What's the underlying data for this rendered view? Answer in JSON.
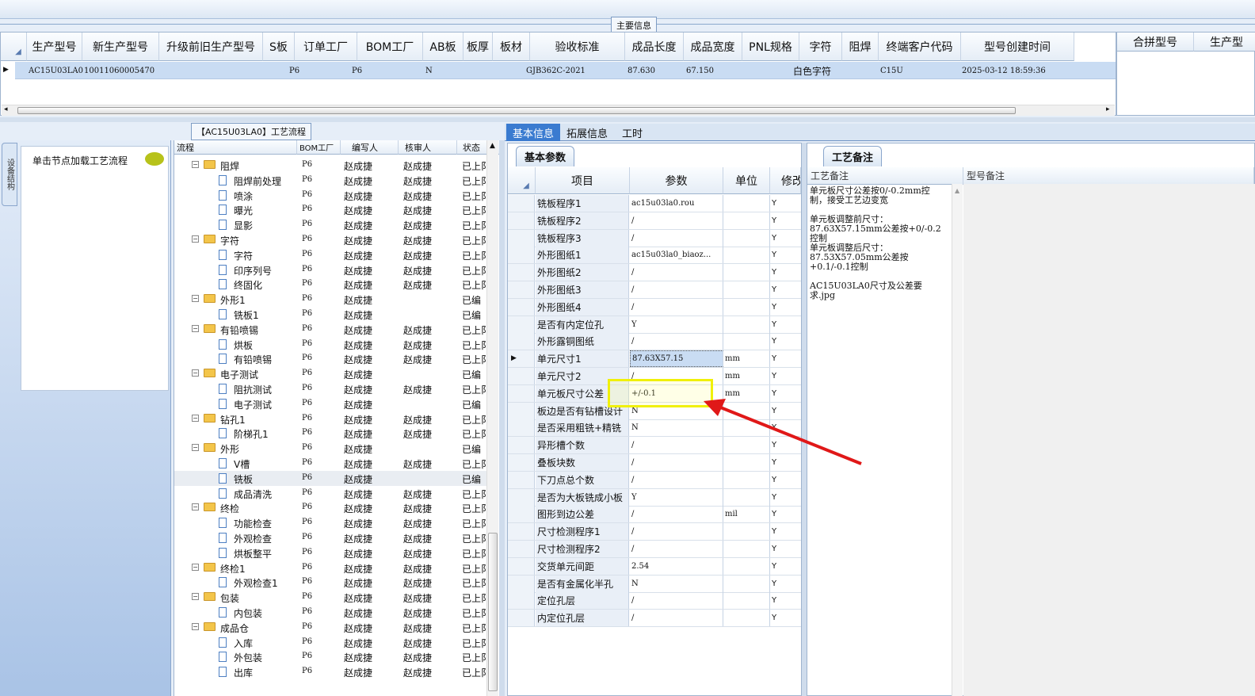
{
  "main_group_label": "主要信息",
  "top_grid": {
    "columns": [
      "生产型号",
      "新生产型号",
      "升级前旧生产型号",
      "S板",
      "订单工厂",
      "BOM工厂",
      "AB板",
      "板厚",
      "板材",
      "验收标准",
      "成品长度",
      "成品宽度",
      "PNL规格",
      "字符",
      "阻焊",
      "终端客户代码",
      "型号创建时间"
    ],
    "row": {
      "生产型号": "AC15U03LA0",
      "新生产型号": "10011060005470",
      "订单工厂": "P6",
      "BOM工厂": "P6",
      "AB板": "N",
      "验收标准": "GJB362C-2021",
      "成品长度": "87.630",
      "成品宽度": "67.150",
      "字符": "白色字符",
      "终端客户代码": "C15U",
      "型号创建时间": "2025-03-12 18:59:36"
    }
  },
  "right_grid": {
    "columns": [
      "合拼型号",
      "生产型"
    ]
  },
  "left_panel": {
    "side_tab": "设备结构",
    "load_hint": "单击节点加载工艺流程"
  },
  "tree": {
    "title": "【AC15U03LA0】工艺流程",
    "columns": [
      "流程",
      "BOM工厂",
      "编写人",
      "核审人",
      "状态"
    ],
    "rows": [
      {
        "level": 1,
        "name": "阻焊",
        "factory": "P6",
        "writer": "赵成捷",
        "reviewer": "赵成捷",
        "status": "已上阝"
      },
      {
        "level": 2,
        "name": "阻焊前处理",
        "factory": "P6",
        "writer": "赵成捷",
        "reviewer": "赵成捷",
        "status": "已上阝"
      },
      {
        "level": 2,
        "name": "喷涂",
        "factory": "P6",
        "writer": "赵成捷",
        "reviewer": "赵成捷",
        "status": "已上阝"
      },
      {
        "level": 2,
        "name": "曝光",
        "factory": "P6",
        "writer": "赵成捷",
        "reviewer": "赵成捷",
        "status": "已上阝"
      },
      {
        "level": 2,
        "name": "显影",
        "factory": "P6",
        "writer": "赵成捷",
        "reviewer": "赵成捷",
        "status": "已上阝"
      },
      {
        "level": 1,
        "name": "字符",
        "factory": "P6",
        "writer": "赵成捷",
        "reviewer": "赵成捷",
        "status": "已上阝"
      },
      {
        "level": 2,
        "name": "字符",
        "factory": "P6",
        "writer": "赵成捷",
        "reviewer": "赵成捷",
        "status": "已上阝"
      },
      {
        "level": 2,
        "name": "印序列号",
        "factory": "P6",
        "writer": "赵成捷",
        "reviewer": "赵成捷",
        "status": "已上阝"
      },
      {
        "level": 2,
        "name": "终固化",
        "factory": "P6",
        "writer": "赵成捷",
        "reviewer": "赵成捷",
        "status": "已上阝"
      },
      {
        "level": 1,
        "name": "外形1",
        "factory": "P6",
        "writer": "赵成捷",
        "reviewer": "",
        "status": "已编"
      },
      {
        "level": 2,
        "name": "铣板1",
        "factory": "P6",
        "writer": "赵成捷",
        "reviewer": "",
        "status": "已编"
      },
      {
        "level": 1,
        "name": "有铅喷锡",
        "factory": "P6",
        "writer": "赵成捷",
        "reviewer": "赵成捷",
        "status": "已上阝"
      },
      {
        "level": 2,
        "name": "烘板",
        "factory": "P6",
        "writer": "赵成捷",
        "reviewer": "赵成捷",
        "status": "已上阝"
      },
      {
        "level": 2,
        "name": "有铅喷锡",
        "factory": "P6",
        "writer": "赵成捷",
        "reviewer": "赵成捷",
        "status": "已上阝"
      },
      {
        "level": 1,
        "name": "电子测试",
        "factory": "P6",
        "writer": "赵成捷",
        "reviewer": "",
        "status": "已编"
      },
      {
        "level": 2,
        "name": "阻抗测试",
        "factory": "P6",
        "writer": "赵成捷",
        "reviewer": "赵成捷",
        "status": "已上阝"
      },
      {
        "level": 2,
        "name": "电子测试",
        "factory": "P6",
        "writer": "赵成捷",
        "reviewer": "",
        "status": "已编"
      },
      {
        "level": 1,
        "name": "钻孔1",
        "factory": "P6",
        "writer": "赵成捷",
        "reviewer": "赵成捷",
        "status": "已上阝"
      },
      {
        "level": 2,
        "name": "阶梯孔1",
        "factory": "P6",
        "writer": "赵成捷",
        "reviewer": "赵成捷",
        "status": "已上阝"
      },
      {
        "level": 1,
        "name": "外形",
        "factory": "P6",
        "writer": "赵成捷",
        "reviewer": "",
        "status": "已编"
      },
      {
        "level": 2,
        "name": "V槽",
        "factory": "P6",
        "writer": "赵成捷",
        "reviewer": "赵成捷",
        "status": "已上阝"
      },
      {
        "level": 2,
        "name": "铣板",
        "factory": "P6",
        "writer": "赵成捷",
        "reviewer": "",
        "status": "已编",
        "selected": true
      },
      {
        "level": 2,
        "name": "成品清洗",
        "factory": "P6",
        "writer": "赵成捷",
        "reviewer": "赵成捷",
        "status": "已上阝"
      },
      {
        "level": 1,
        "name": "终检",
        "factory": "P6",
        "writer": "赵成捷",
        "reviewer": "赵成捷",
        "status": "已上阝"
      },
      {
        "level": 2,
        "name": "功能检查",
        "factory": "P6",
        "writer": "赵成捷",
        "reviewer": "赵成捷",
        "status": "已上阝"
      },
      {
        "level": 2,
        "name": "外观检查",
        "factory": "P6",
        "writer": "赵成捷",
        "reviewer": "赵成捷",
        "status": "已上阝"
      },
      {
        "level": 2,
        "name": "烘板整平",
        "factory": "P6",
        "writer": "赵成捷",
        "reviewer": "赵成捷",
        "status": "已上阝"
      },
      {
        "level": 1,
        "name": "终检1",
        "factory": "P6",
        "writer": "赵成捷",
        "reviewer": "赵成捷",
        "status": "已上阝"
      },
      {
        "level": 2,
        "name": "外观检查1",
        "factory": "P6",
        "writer": "赵成捷",
        "reviewer": "赵成捷",
        "status": "已上阝"
      },
      {
        "level": 1,
        "name": "包装",
        "factory": "P6",
        "writer": "赵成捷",
        "reviewer": "赵成捷",
        "status": "已上阝"
      },
      {
        "level": 2,
        "name": "内包装",
        "factory": "P6",
        "writer": "赵成捷",
        "reviewer": "赵成捷",
        "status": "已上阝"
      },
      {
        "level": 1,
        "name": "成品仓",
        "factory": "P6",
        "writer": "赵成捷",
        "reviewer": "赵成捷",
        "status": "已上阝"
      },
      {
        "level": 2,
        "name": "入库",
        "factory": "P6",
        "writer": "赵成捷",
        "reviewer": "赵成捷",
        "status": "已上阝"
      },
      {
        "level": 2,
        "name": "外包装",
        "factory": "P6",
        "writer": "赵成捷",
        "reviewer": "赵成捷",
        "status": "已上阝"
      },
      {
        "level": 2,
        "name": "出库",
        "factory": "P6",
        "writer": "赵成捷",
        "reviewer": "赵成捷",
        "status": "已上阝"
      }
    ]
  },
  "tabs": [
    "基本信息",
    "拓展信息",
    "工时"
  ],
  "params": {
    "subtab": "基本参数",
    "columns": [
      "项目",
      "参数",
      "单位",
      "修改"
    ],
    "rows": [
      {
        "item": "铣板程序1",
        "value": "ac15u03la0.rou",
        "unit": "",
        "mod": "Y"
      },
      {
        "item": "铣板程序2",
        "value": "/",
        "unit": "",
        "mod": "Y"
      },
      {
        "item": "铣板程序3",
        "value": "/",
        "unit": "",
        "mod": "Y"
      },
      {
        "item": "外形图纸1",
        "value": "ac15u03la0_biaoz...",
        "unit": "",
        "mod": "Y"
      },
      {
        "item": "外形图纸2",
        "value": "/",
        "unit": "",
        "mod": "Y"
      },
      {
        "item": "外形图纸3",
        "value": "/",
        "unit": "",
        "mod": "Y"
      },
      {
        "item": "外形图纸4",
        "value": "/",
        "unit": "",
        "mod": "Y"
      },
      {
        "item": "是否有内定位孔",
        "value": "Y",
        "unit": "",
        "mod": "Y"
      },
      {
        "item": "外形露铜图纸",
        "value": "/",
        "unit": "",
        "mod": "Y"
      },
      {
        "item": "单元尺寸1",
        "value": "87.63X57.15",
        "unit": "mm",
        "mod": "Y",
        "selected": true
      },
      {
        "item": "单元尺寸2",
        "value": "/",
        "unit": "mm",
        "mod": "Y"
      },
      {
        "item": "单元板尺寸公差",
        "value": "+/-0.1",
        "unit": "mm",
        "mod": "Y"
      },
      {
        "item": "板边是否有钻槽设计",
        "value": "N",
        "unit": "",
        "mod": "Y"
      },
      {
        "item": "是否采用粗铣+精铣",
        "value": "N",
        "unit": "",
        "mod": "Y"
      },
      {
        "item": "异形槽个数",
        "value": "/",
        "unit": "",
        "mod": "Y"
      },
      {
        "item": "叠板块数",
        "value": "/",
        "unit": "",
        "mod": "Y"
      },
      {
        "item": "下刀点总个数",
        "value": "/",
        "unit": "",
        "mod": "Y"
      },
      {
        "item": "是否为大板铣成小板",
        "value": "Y",
        "unit": "",
        "mod": "Y"
      },
      {
        "item": "图形到边公差",
        "value": "/",
        "unit": "mil",
        "mod": "Y"
      },
      {
        "item": "尺寸检测程序1",
        "value": "/",
        "unit": "",
        "mod": "Y"
      },
      {
        "item": "尺寸检测程序2",
        "value": "/",
        "unit": "",
        "mod": "Y"
      },
      {
        "item": "交货单元间距",
        "value": "2.54",
        "unit": "",
        "mod": "Y"
      },
      {
        "item": "是否有金属化半孔",
        "value": "N",
        "unit": "",
        "mod": "Y"
      },
      {
        "item": "定位孔层",
        "value": "/",
        "unit": "",
        "mod": "Y"
      },
      {
        "item": "内定位孔层",
        "value": "/",
        "unit": "",
        "mod": "Y"
      }
    ]
  },
  "notes": {
    "subtab": "工艺备注",
    "columns": [
      "工艺备注",
      "型号备注"
    ],
    "paragraphs": [
      "单元板尺寸公差按0/-0.2mm控制，接受工艺边变宽",
      "单元板调整前尺寸：87.63X57.15mm公差按+0/-0.2控制\n单元板调整后尺寸：87.53X57.05mm公差按+0.1/-0.1控制",
      "AC15U03LA0尺寸及公差要求.jpg"
    ]
  },
  "colors": {
    "accent": "#3a7bd0",
    "highlight": "#f0f00a",
    "arrow": "#e01818"
  }
}
